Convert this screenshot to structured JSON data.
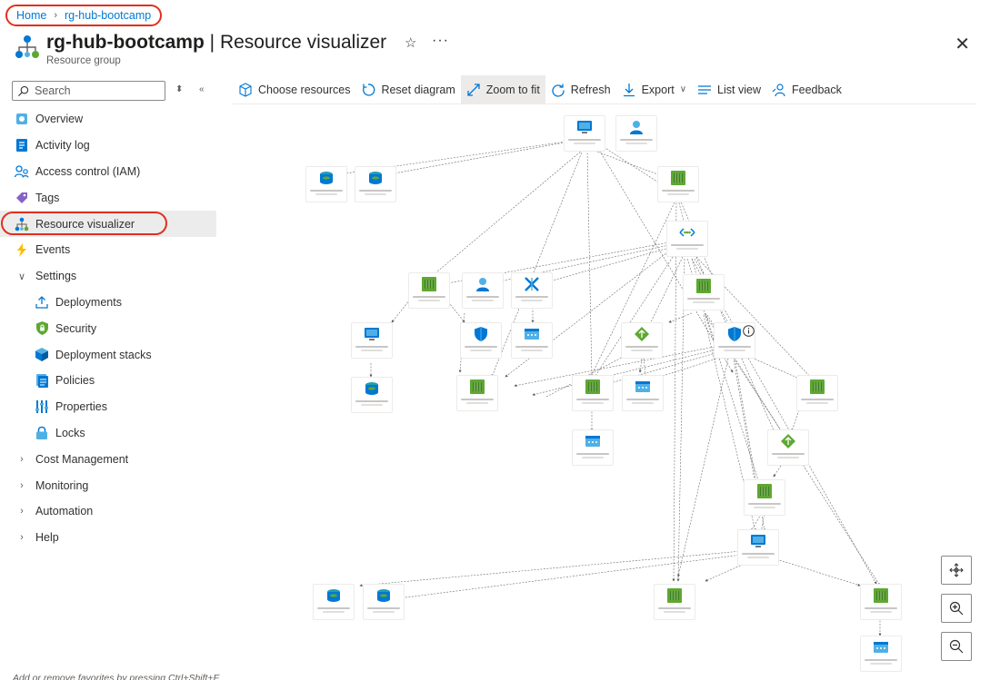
{
  "breadcrumb": {
    "home": "Home",
    "current": "rg-hub-bootcamp"
  },
  "header": {
    "resource_name": "rg-hub-bootcamp",
    "separator": " | ",
    "blade": "Resource visualizer",
    "subtitle": "Resource group",
    "more": "···"
  },
  "search": {
    "placeholder": "Search"
  },
  "nav": [
    {
      "label": "Overview",
      "icon": "overview-icon"
    },
    {
      "label": "Activity log",
      "icon": "activity-log-icon"
    },
    {
      "label": "Access control (IAM)",
      "icon": "iam-icon"
    },
    {
      "label": "Tags",
      "icon": "tag-icon"
    },
    {
      "label": "Resource visualizer",
      "icon": "resource-visualizer-icon",
      "active": true
    },
    {
      "label": "Events",
      "icon": "lightning-icon"
    },
    {
      "label": "Settings",
      "expanded": true
    },
    {
      "label": "Deployments",
      "icon": "deployments-icon"
    },
    {
      "label": "Security",
      "icon": "shield-icon"
    },
    {
      "label": "Deployment stacks",
      "icon": "stacks-icon"
    },
    {
      "label": "Policies",
      "icon": "policies-icon"
    },
    {
      "label": "Properties",
      "icon": "properties-icon"
    },
    {
      "label": "Locks",
      "icon": "lock-icon"
    },
    {
      "label": "Cost Management",
      "expanded": false
    },
    {
      "label": "Monitoring",
      "expanded": false
    },
    {
      "label": "Automation",
      "expanded": false
    },
    {
      "label": "Help",
      "expanded": false
    }
  ],
  "footer_hint": "Add or remove favorites by pressing Ctrl+Shift+F",
  "toolbar": {
    "choose": "Choose resources",
    "reset": "Reset diagram",
    "zoom": "Zoom to fit",
    "refresh": "Refresh",
    "export": "Export",
    "list": "List view",
    "feedback": "Feedback"
  },
  "colors": {
    "accent": "#0078d4",
    "highlight_ring": "#e0301e",
    "nic_green": "#5ea832",
    "vm_blue": "#0078d4",
    "disk_teal": "#1e9fb6"
  },
  "diagram": {
    "node_types": [
      "virtual-machine",
      "user-identity",
      "disk",
      "network-interface",
      "virtual-network",
      "network-security-group",
      "public-ip",
      "load-balancer",
      "bastion"
    ]
  }
}
